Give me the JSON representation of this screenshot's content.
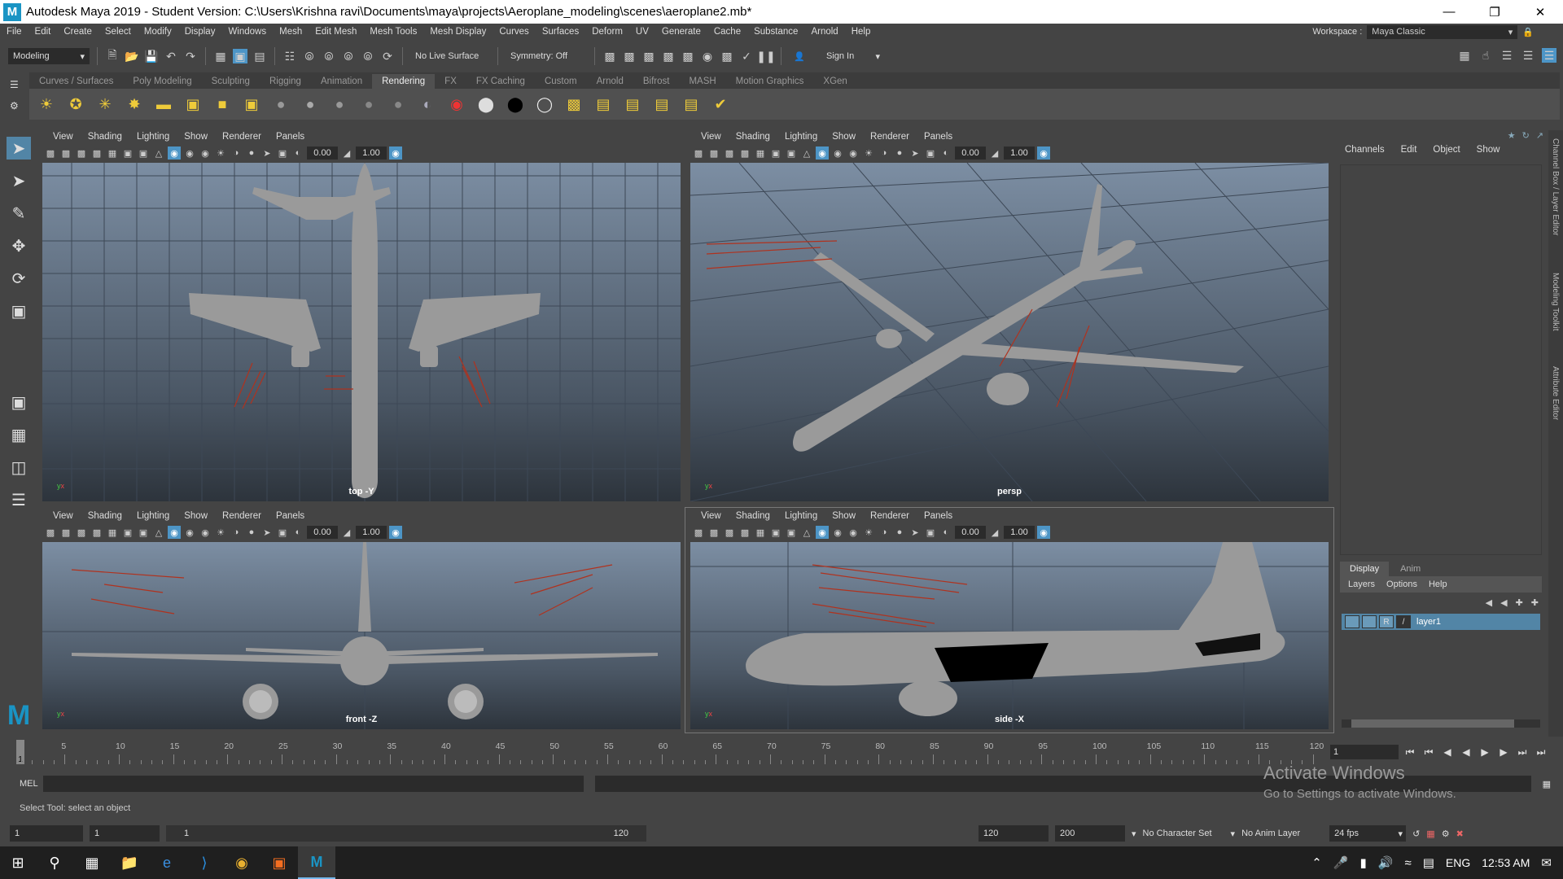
{
  "window": {
    "title": "Autodesk Maya 2019 - Student Version: C:\\Users\\Krishna ravi\\Documents\\maya\\projects\\Aeroplane_modeling\\scenes\\aeroplane2.mb*",
    "logo": "M"
  },
  "menu": [
    "File",
    "Edit",
    "Create",
    "Select",
    "Modify",
    "Display",
    "Windows",
    "Mesh",
    "Edit Mesh",
    "Mesh Tools",
    "Mesh Display",
    "Curves",
    "Surfaces",
    "Deform",
    "UV",
    "Generate",
    "Cache",
    "Substance",
    "Arnold",
    "Help"
  ],
  "workspace": {
    "label": "Workspace :",
    "value": "Maya Classic"
  },
  "statusline": {
    "mode": "Modeling",
    "live_surface": "No Live Surface",
    "symmetry": "Symmetry: Off",
    "sign_in": "Sign In"
  },
  "shelf_tabs": [
    "Curves / Surfaces",
    "Poly Modeling",
    "Sculpting",
    "Rigging",
    "Animation",
    "Rendering",
    "FX",
    "FX Caching",
    "Custom",
    "Arnold",
    "Bifrost",
    "MASH",
    "Motion Graphics",
    "XGen"
  ],
  "active_shelf": "Rendering",
  "panel_menu": [
    "View",
    "Shading",
    "Lighting",
    "Show",
    "Renderer",
    "Panels"
  ],
  "panel_values": {
    "exposure": "0.00",
    "gamma": "1.00"
  },
  "viewports": {
    "top": {
      "camera": "top -Y"
    },
    "persp": {
      "camera": "persp"
    },
    "front": {
      "camera": "front -Z"
    },
    "side": {
      "camera": "side -X"
    }
  },
  "channel_box": {
    "menu": [
      "Channels",
      "Edit",
      "Object",
      "Show"
    ]
  },
  "layer_editor": {
    "tabs": [
      "Display",
      "Anim"
    ],
    "menu": [
      "Layers",
      "Options",
      "Help"
    ],
    "layer": {
      "visible": "",
      "ref": "R",
      "name": "layer1"
    }
  },
  "side_tabs": [
    "Channel Box / Layer Editor",
    "Modeling Toolkit",
    "Attribute Editor"
  ],
  "timeline": {
    "ticks": [
      "5",
      "10",
      "15",
      "20",
      "25",
      "30",
      "35",
      "40",
      "45",
      "50",
      "55",
      "60",
      "65",
      "70",
      "75",
      "80",
      "85",
      "90",
      "95",
      "100",
      "105",
      "110",
      "115",
      "120"
    ],
    "current_frame": "1",
    "current_field": "1"
  },
  "command": {
    "lang": "MEL"
  },
  "help_line": "Select Tool: select an object",
  "watermark": {
    "line1": "Activate Windows",
    "line2": "Go to Settings to activate Windows."
  },
  "range": {
    "start": "1",
    "playback_start": "1",
    "slider_start": "1",
    "slider_end": "120",
    "playback_end": "120",
    "end": "200",
    "character_set": "No Character Set",
    "anim_layer": "No Anim Layer",
    "fps": "24 fps"
  },
  "taskbar": {
    "lang": "ENG",
    "time": "12:53 AM"
  }
}
